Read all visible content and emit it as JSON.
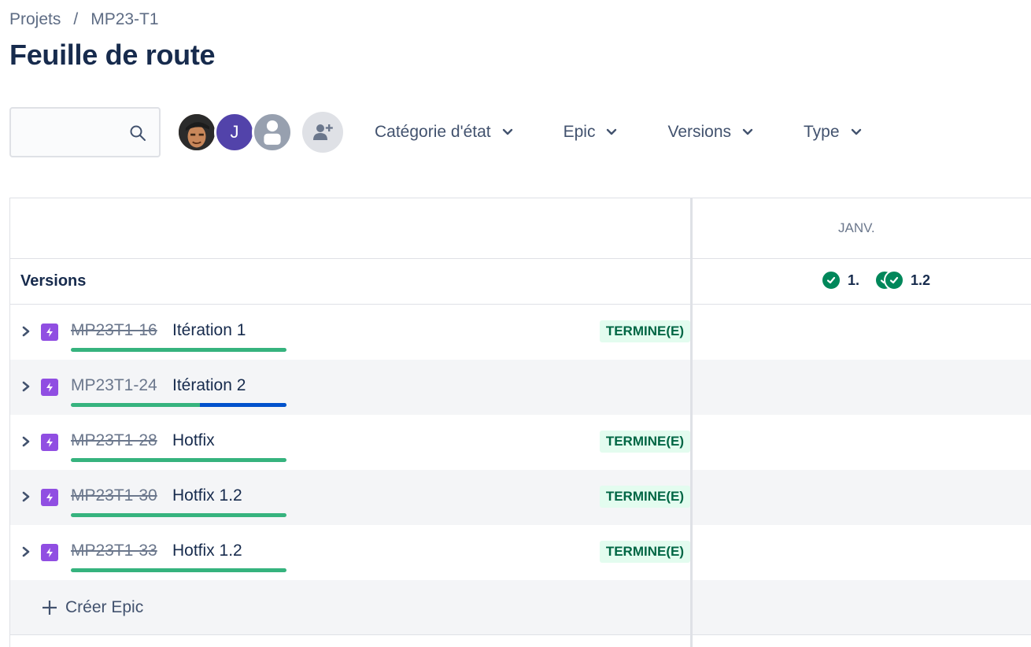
{
  "breadcrumb": {
    "root": "Projets",
    "separator": "/",
    "project": "MP23-T1"
  },
  "page_title": "Feuille de route",
  "search": {
    "placeholder": "",
    "value": ""
  },
  "avatars": [
    {
      "kind": "photo",
      "initial": ""
    },
    {
      "kind": "initial",
      "initial": "J"
    },
    {
      "kind": "generic",
      "initial": ""
    }
  ],
  "filters": [
    {
      "label": "Catégorie d'état"
    },
    {
      "label": "Epic"
    },
    {
      "label": "Versions"
    },
    {
      "label": "Type"
    }
  ],
  "timeline": {
    "month": "JANV."
  },
  "versions_row": {
    "label": "Versions",
    "releases": [
      {
        "label": "1."
      },
      {
        "label": ""
      },
      {
        "label": "1.2"
      }
    ]
  },
  "epics": [
    {
      "key": "MP23T1-16",
      "title": "Itération 1",
      "done": true,
      "status": "TERMINE(E)",
      "progress_done": 1.0
    },
    {
      "key": "MP23T1-24",
      "title": "Itération 2",
      "done": false,
      "status": "",
      "progress_done": 0.6
    },
    {
      "key": "MP23T1-28",
      "title": "Hotfix",
      "done": true,
      "status": "TERMINE(E)",
      "progress_done": 1.0
    },
    {
      "key": "MP23T1-30",
      "title": "Hotfix 1.2",
      "done": true,
      "status": "TERMINE(E)",
      "progress_done": 1.0
    },
    {
      "key": "MP23T1-33",
      "title": "Hotfix 1.2",
      "done": true,
      "status": "TERMINE(E)",
      "progress_done": 1.0
    }
  ],
  "create_epic": {
    "label": "Créer Epic"
  },
  "colors": {
    "done_green": "#36b37e",
    "in_progress_blue": "#0052cc",
    "epic_purple": "#904ee2",
    "release_green": "#00875a"
  }
}
